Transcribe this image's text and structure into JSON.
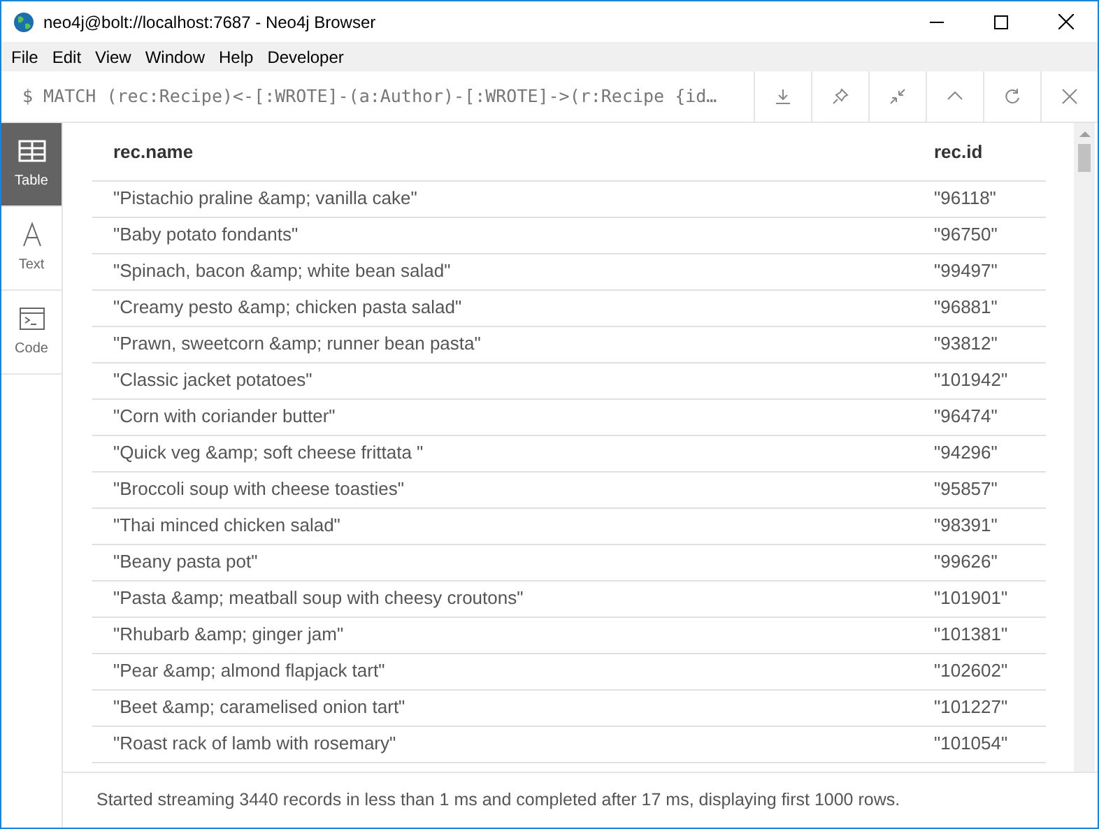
{
  "window": {
    "title": "neo4j@bolt://localhost:7687 - Neo4j Browser"
  },
  "menu": [
    "File",
    "Edit",
    "View",
    "Window",
    "Help",
    "Developer"
  ],
  "query": "$ MATCH (rec:Recipe)<-[:WROTE]-(a:Author)-[:WROTE]->(r:Recipe {id…",
  "toolbar": [
    {
      "kind": "download"
    },
    {
      "kind": "pin"
    },
    {
      "kind": "collapse"
    },
    {
      "kind": "up"
    },
    {
      "kind": "rerun"
    },
    {
      "kind": "close"
    }
  ],
  "sidebar": [
    {
      "kind": "table",
      "label": "Table",
      "selected": true
    },
    {
      "kind": "text",
      "label": "Text",
      "selected": false
    },
    {
      "kind": "code",
      "label": "Code",
      "selected": false
    }
  ],
  "table": {
    "columns": [
      "rec.name",
      "rec.id"
    ],
    "rows": [
      [
        "\"Pistachio praline &amp; vanilla cake\"",
        "\"96118\""
      ],
      [
        "\"Baby potato fondants\"",
        "\"96750\""
      ],
      [
        "\"Spinach, bacon &amp; white bean salad\"",
        "\"99497\""
      ],
      [
        "\"Creamy pesto &amp; chicken pasta salad\"",
        "\"96881\""
      ],
      [
        "\"Prawn, sweetcorn &amp; runner bean pasta\"",
        "\"93812\""
      ],
      [
        "\"Classic jacket potatoes\"",
        "\"101942\""
      ],
      [
        "\"Corn with coriander butter\"",
        "\"96474\""
      ],
      [
        "\"Quick veg &amp; soft cheese frittata \"",
        "\"94296\""
      ],
      [
        "\"Broccoli soup with cheese toasties\"",
        "\"95857\""
      ],
      [
        "\"Thai minced chicken salad\"",
        "\"98391\""
      ],
      [
        "\"Beany pasta pot\"",
        "\"99626\""
      ],
      [
        "\"Pasta &amp; meatball soup with cheesy croutons\"",
        "\"101901\""
      ],
      [
        "\"Rhubarb &amp; ginger jam\"",
        "\"101381\""
      ],
      [
        "\"Pear &amp; almond flapjack tart\"",
        "\"102602\""
      ],
      [
        "\"Beet &amp; caramelised onion tart\"",
        "\"101227\""
      ],
      [
        "\"Roast rack of lamb with rosemary\"",
        "\"101054\""
      ]
    ]
  },
  "status_bar": "Started streaming 3440 records in less than 1 ms and completed after 17 ms, displaying first 1000 rows."
}
